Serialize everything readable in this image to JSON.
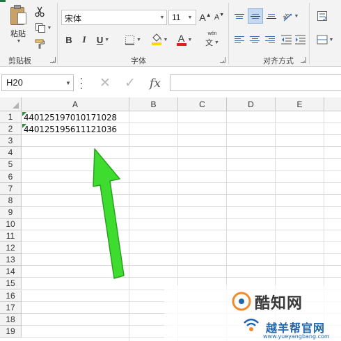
{
  "ribbon": {
    "clipboard": {
      "paste_label": "粘贴",
      "group_label": "剪贴板"
    },
    "font": {
      "font_name": "宋体",
      "font_size": "11",
      "bold_label": "B",
      "italic_label": "I",
      "underline_label": "U",
      "grow_label": "A",
      "shrink_label": "A",
      "font_color_label": "A",
      "phonetic_label": "wén",
      "phonetic_char": "文",
      "group_label": "字体"
    },
    "alignment": {
      "group_label": "对齐方式"
    }
  },
  "formula_bar": {
    "name_box": "H20",
    "cancel_label": "✕",
    "enter_label": "✓",
    "fx_label": "fx",
    "formula": ""
  },
  "grid": {
    "columns": [
      "A",
      "B",
      "C",
      "D",
      "E"
    ],
    "rows": [
      "1",
      "2",
      "3",
      "4",
      "5",
      "6",
      "7",
      "8",
      "9",
      "10",
      "11",
      "12",
      "13",
      "14",
      "15",
      "16",
      "17",
      "18",
      "19"
    ],
    "cells": {
      "A1": "440125197010171028",
      "A2": "440125195611121036"
    }
  },
  "annotation": {
    "arrow_color": "#3ddc2e"
  },
  "watermark": {
    "title": "酷知网",
    "cn_text": "越羊帮官网",
    "url": "www.yueyangbang.com"
  },
  "colors": {
    "ribbon_bg": "#f3f3f3",
    "header_bg": "#f3f3f3",
    "grid_line": "#dedede",
    "error_indicator": "#2e8b3a",
    "font_color_bar": "#e02020",
    "fill_color_bar": "#ffd800"
  }
}
